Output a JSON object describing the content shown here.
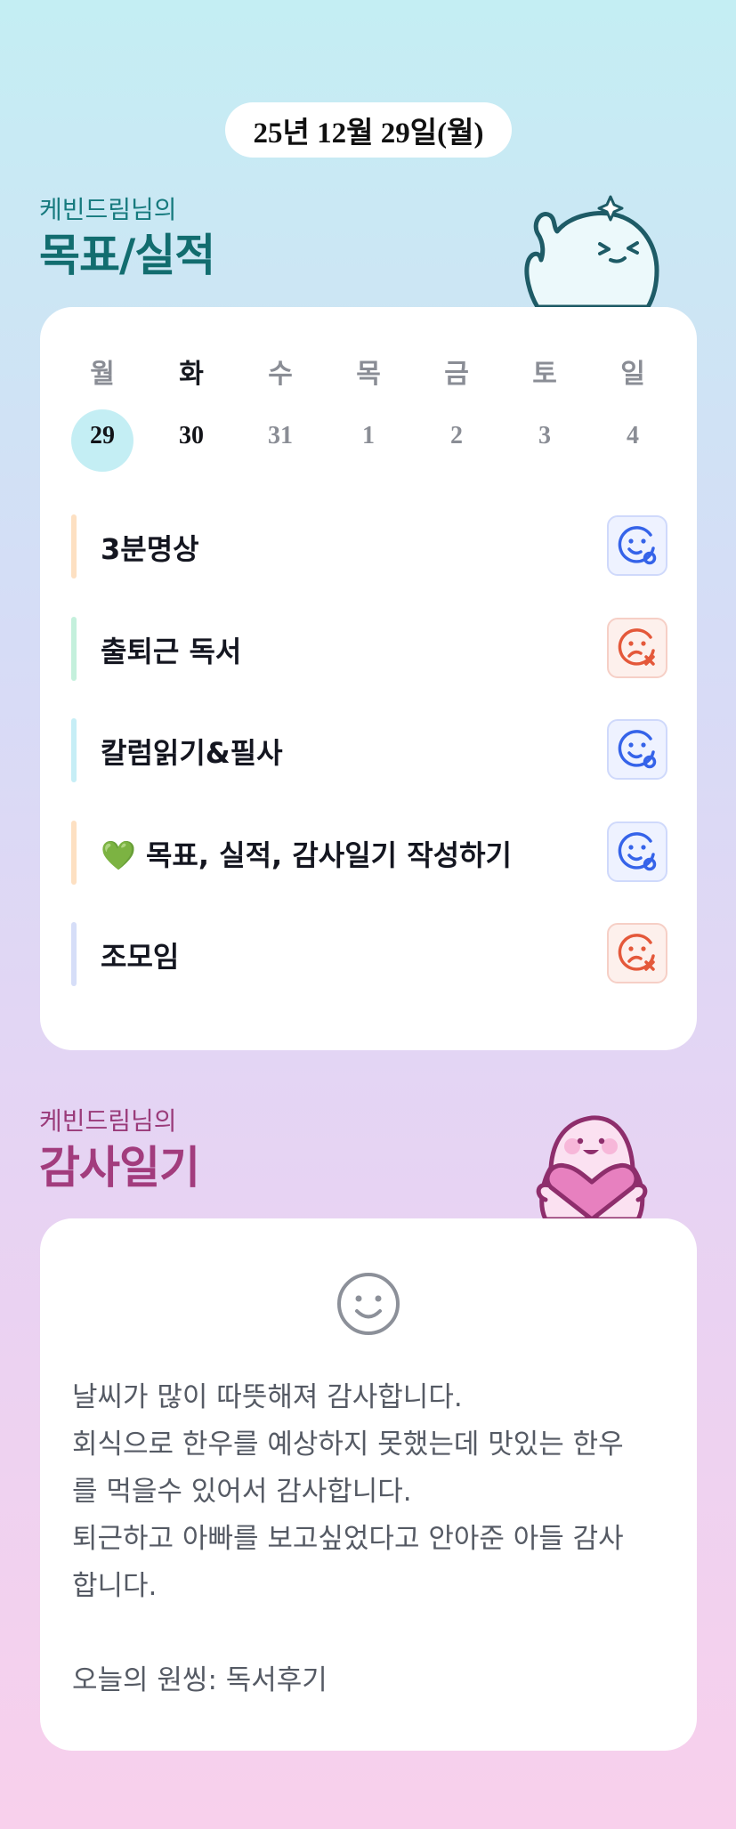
{
  "date": "25년 12월 29일(월)",
  "goals_section": {
    "subtitle": "케빈드림님의",
    "title": "목표/실적",
    "week": {
      "weekdays": [
        "월",
        "화",
        "수",
        "목",
        "금",
        "토",
        "일"
      ],
      "days": [
        "29",
        "30",
        "31",
        "1",
        "2",
        "3",
        "4"
      ],
      "selected_index": 0
    },
    "goals": [
      {
        "label": "3분명상",
        "status": "success",
        "accent": "#fde0c2"
      },
      {
        "label": "출퇴근 독서",
        "status": "fail",
        "accent": "#c4f0dc"
      },
      {
        "label": "칼럼읽기&필사",
        "status": "success",
        "accent": "#c6eef6"
      },
      {
        "label": "💚 목표, 실적, 감사일기 작성하기",
        "status": "success",
        "accent": "#fde0c2"
      },
      {
        "label": "조모임",
        "status": "fail",
        "accent": "#d6def8"
      }
    ]
  },
  "gratitude_section": {
    "subtitle": "케빈드림님의",
    "title": "감사일기",
    "mood_icon": "smile-icon",
    "lines": [
      "날씨가 많이 따뜻해져 감사합니다.",
      "회식으로 한우를 예상하지 못했는데 맛있는 한우",
      "를 먹을수 있어서 감사합니다.",
      "퇴근하고 아빠를 보고싶었다고 안아준 아들 감사",
      "합니다.",
      "",
      "오늘의 원씽: 독서후기"
    ]
  },
  "colors": {
    "goals_title": "#126d6f",
    "gratitude_title": "#a23c7d",
    "success": "#3563e9",
    "fail": "#e4583a"
  },
  "icons": {
    "success": "smile-success-icon",
    "fail": "frown-fail-icon",
    "goals_mascot": "waving-mascot",
    "gratitude_mascot": "heart-mascot"
  }
}
